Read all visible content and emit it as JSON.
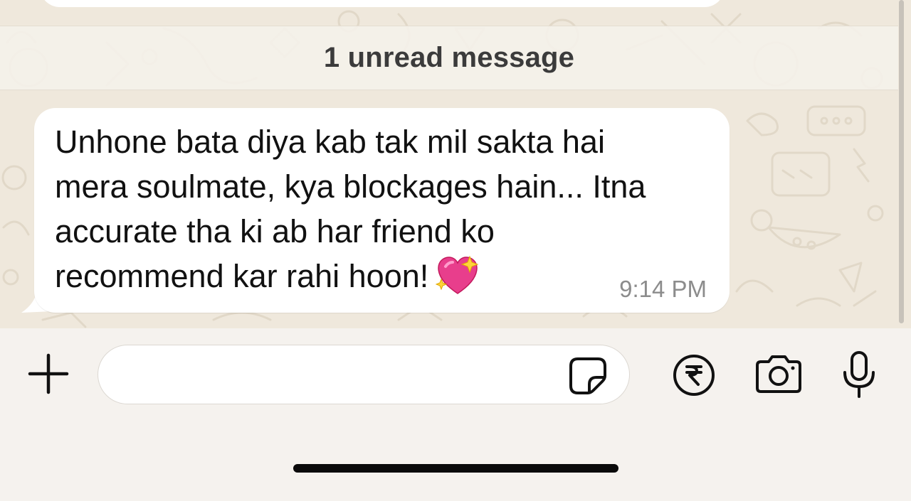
{
  "chat": {
    "unread_banner": "1 unread message",
    "message": {
      "text": "Unhone bata diya kab tak mil sakta hai\nmera soulmate, kya blockages hain... Itna\naccurate tha ki ab har friend ko\nrecommend kar rahi hoon!",
      "emoji": "sparkling-heart",
      "time": "9:14 PM"
    }
  },
  "composer": {
    "value": "",
    "placeholder": ""
  },
  "icons": {
    "attach": "plus-icon",
    "sticker": "sticker-icon",
    "payment": "rupee-icon",
    "camera": "camera-icon",
    "voice": "microphone-icon"
  },
  "colors": {
    "chat_background": "#efe8dc",
    "bubble": "#ffffff",
    "emoji_heart": "#e83e8c"
  }
}
